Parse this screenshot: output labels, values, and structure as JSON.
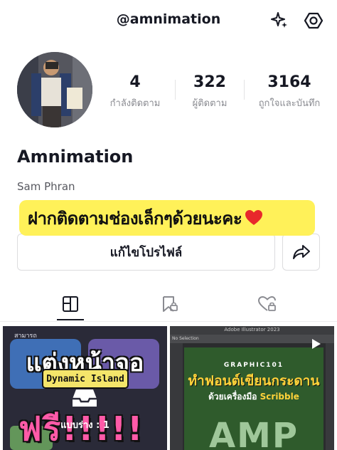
{
  "header": {
    "username": "@amnimation",
    "icons": [
      "sparkle-icon",
      "settings-hexagon-icon"
    ]
  },
  "profile": {
    "display_name": "Amnimation",
    "bio_name": "Sam Phran"
  },
  "stats": [
    {
      "value": "4",
      "label": "กำลังติดตาม"
    },
    {
      "value": "322",
      "label": "ผู้ติดตาม"
    },
    {
      "value": "3164",
      "label": "ถูกใจและบันทึก"
    }
  ],
  "banner": {
    "text": "ฝากติดตามช่องเล็กๆด้วยนะคะ",
    "background": "#fff159"
  },
  "actions": {
    "edit_profile": "แก้ไขโปรไฟล์"
  },
  "tabs": [
    "grid-icon",
    "bookmark-lock-icon",
    "heart-lock-icon"
  ],
  "posts": [
    {
      "small_text": "สามารถ",
      "title": "แต่งหน้าจอ",
      "pill": "Dynamic Island",
      "big": "ฟรี!!!!!",
      "draft_label": "แบบร่าง : 1"
    },
    {
      "app_title": "Adobe Illustrator 2023",
      "toolbar": "No Selection",
      "heading": "GRAPHIC101",
      "title": "ทำฟอนต์เขียนกระดาน",
      "subtitle_prefix": "ด้วยเครื่องมือ",
      "subtitle_tool": "Scribble",
      "big": "AMP"
    }
  ]
}
